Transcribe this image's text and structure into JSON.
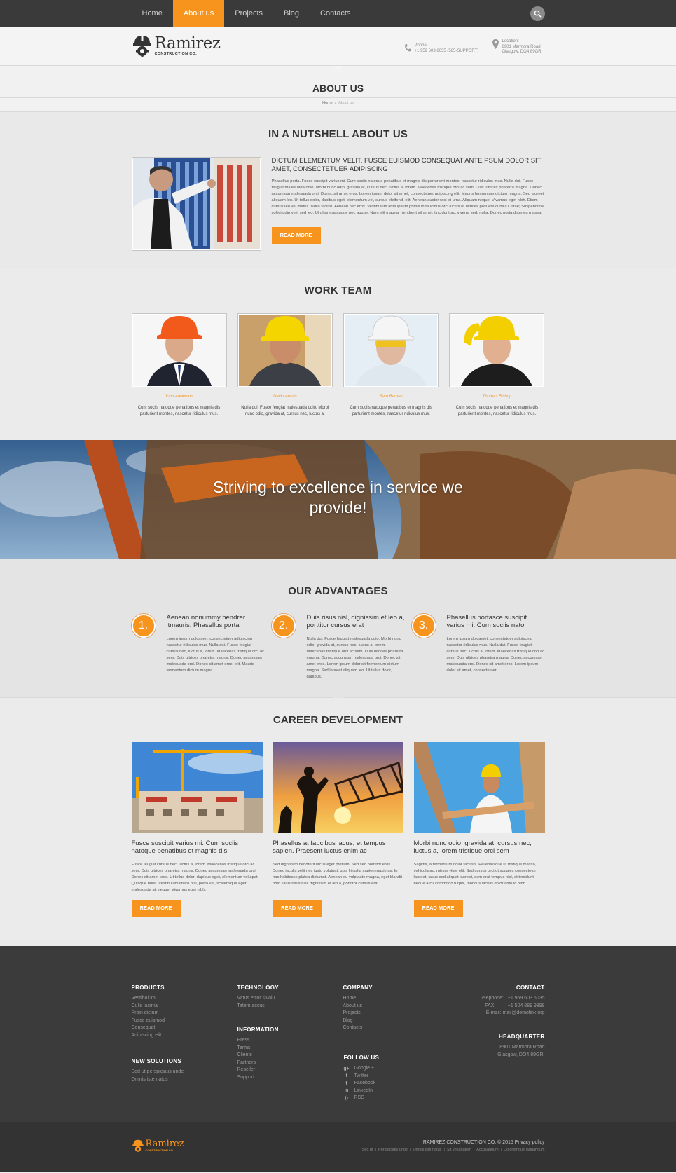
{
  "nav": {
    "items": [
      "Home",
      "About us",
      "Projects",
      "Blog",
      "Contacts"
    ],
    "active_index": 1
  },
  "header": {
    "logo_name": "Ramirez",
    "logo_sub": "CONSTRUCTION CO.",
    "phone_label": "Phone:",
    "phone_value": "+1 959 603 6035 (585-SUPPORT)",
    "location_label": "Location:",
    "location_line1": "8901 Marmora Road",
    "location_line2": "Glasgow, DO4 89GR."
  },
  "page_title": {
    "title": "ABOUT US",
    "breadcrumb_home": "Home",
    "breadcrumb_sep": "/",
    "breadcrumb_current": "About us"
  },
  "nutshell": {
    "heading": "IN A NUTSHELL ABOUT US",
    "subheading": "DICTUM ELEMENTUM VELIT. FUSCE EUISMOD CONSEQUAT ANTE PSUM DOLOR SIT AMET, CONSECTETUER ADIPISCING",
    "body": "Phasellus porta. Fusce suscipit varius mi. Cum sociis natoque penatibus et magnis dis parturient montes, nascetur ridiculus mus. Nulla dui. Fusce feugiat malesuada odio. Morbi nunc odio, gravida at, cursus nec, luctus a, lorem. Maecenas tristique orci ac sem. Duis ultrices pharetra magna. Donec accumsan malesuada orci. Donec sit amet eros. Lorem ipsum dolor sit amet, consectetuer adipiscing elit. Mauris fermentum dictum magna. Sed laoreet aliquam leo. Ut tellus dolor, dapibus eget, elementum vel, cursus eleifend, elit. Aenean auctor wisi et urna. Aliquam neque. Vivamus eget nibh. Etiam cursus leo vel metus. Nulla facilisi. Aenean nec eros. Vestibulum ante ipsum primis in faucibus orci luctus et ultrices posuere cubilia Curae; Suspendisse sollicitudin velit sed leo. Ut pharetra augue nec augue. Nam elit magna, hendrerit sit amet, tincidunt ac, viverra sed, nulla. Donec porta diam eu massa.",
    "button": "READ MORE"
  },
  "team": {
    "heading": "WORK TEAM",
    "members": [
      {
        "name": "John Anderson",
        "desc": "Cum sociis natoque penatibus et magnis dis parturient montes, nascetur ridiculus mus."
      },
      {
        "name": "David Austin",
        "desc": "Nulla dui. Fusce feugiat malesuada odio. Morbi nunc odio, gravida at, cursus nec, luctus a."
      },
      {
        "name": "Sam Barnes",
        "desc": "Cum sociis natoque penatibus et magnis dis parturient montes, nascetur ridiculus mus."
      },
      {
        "name": "Thomas Bishop",
        "desc": "Cum sociis natoque penatibus et magnis dis parturient montes, nascetur ridiculus mus."
      }
    ]
  },
  "banner": {
    "line1": "Striving to excellence in service we",
    "line2": "provide!"
  },
  "advantages": {
    "heading": "OUR ADVANTAGES",
    "items": [
      {
        "num": "1.",
        "head": "Aenean nonummy hendrer itmauris. Phasellus porta",
        "body": "Lorem ipsum dolcamet, consectetuer adipiscing nascetur ridiculus mus. Nulla dui. Fusce feugiat cursus nec, luctus a, lorem. Maecenas tristique orci ac sem. Duis ultrices pharetra magna. Donec accumsan malesuada orci. Donec sit amet eros. elit. Mauris fermentum dictum magna."
      },
      {
        "num": "2.",
        "head": "Duis risus nisl, dignissim et leo a, porttitor cursus erat",
        "body": "Nulla dui. Fusce feugiat malesuada odio. Morbi nunc odio, gravida at, cursus nec, luctus a, lorem. Maecenas tristique orci ac sem. Duis ultrices pharetra magna. Donec accumsan malesuada orci. Donec sit amet eros. Lorem ipsum dolor sit fermentum dictum magna. Sed laoreet aliquam leo. Ut tellus dolor, dapibus."
      },
      {
        "num": "3.",
        "head": "Phasellus portasce suscipit varius mi. Cum sociis nato",
        "body": "Lorem ipsum dolcamet, consectetuer adipiscing nascetur ridiculus mus. Nulla dui. Fusce feugiat cursus nec, luctus a, lorem. Maecenas tristique orci ac sem. Duis ultrices pharetra magna. Donec accumsan malesuada orci. Donec sit amet eros. Lorem ipsum dolor sit amet, consectetuer."
      }
    ]
  },
  "career": {
    "heading": "CAREER DEVELOPMENT",
    "items": [
      {
        "head": "Fusce suscipit varius mi. Cum sociis natoque penatibus et magnis dis",
        "body": "Fusce feugiat cursus nec, luctus a, lorem. Maecenas tristique orci ac sem. Duis ultrices pharetra magna. Donec accumsan malesuada orci. Donec sit amet eros. Ut tellus dolor, dapibus eget, elementum volutpat. Quisque nulla. Vestibulum libero nisl, porta vel, scelerisque eget, malesuada at, neque. Vivamus eget nibh.",
        "button": "READ MORE"
      },
      {
        "head": "Phasellus at faucibus lacus, et tempus sapien. Praesent luctus enim ac",
        "body": "Sed dignissim hendrerit lacus eget pretium. Sed sed porttitor eros. Donec iaculis velit nec justo volutpat, quis fringilla sapien maximus. In hac habitasse platea dictumst. Aenean eu vulputate magna, eget blandit odio. Duis risus nisl, dignissim et leo a, porttitor cursus erat.",
        "button": "READ MORE"
      },
      {
        "head": "Morbi nunc odio, gravida at, cursus nec, luctus a, lorem tristique orci sem",
        "body": "Sagittis, a fermentum dolor facilisis. Pellentesque ut tristique massa, vehicula ac, rutrum vitae elit. Sed cursus orci ut sodales consectetur laoreet, lacus sed aliquet laoreet, sem erat tempus nisl, et tincidunt neque arcu commodo turpis, rhoncus iaculis dolor ante id nibh.",
        "button": "READ MORE"
      }
    ]
  },
  "footer": {
    "products": {
      "title": "PRODUCTS",
      "items": [
        "Vestibulum",
        "Culis lacinia",
        "Proin dictum",
        "Fusce euismod",
        "Consequat",
        "Adipiscing elit"
      ]
    },
    "new_solutions": {
      "title": "NEW SOLUTIONS",
      "items": [
        "Sed ut perspiciatis unde",
        "Omnis iste natus"
      ]
    },
    "technology": {
      "title": "TECHNOLOGY",
      "items": [
        "Vatus error sivolu",
        "Tatem accus"
      ]
    },
    "information": {
      "title": "INFORMATION",
      "items": [
        "Press",
        "Terms",
        "Clients",
        "Partners",
        "Reseller",
        "Support"
      ]
    },
    "company": {
      "title": "COMPANY",
      "items": [
        "Home",
        "About us",
        "Projects",
        "Blog",
        "Contacts"
      ]
    },
    "follow": {
      "title": "FOLLOW US",
      "items": [
        {
          "icon": "google-plus-icon",
          "glyph": "g+",
          "label": "Google +"
        },
        {
          "icon": "twitter-icon",
          "glyph": "t",
          "label": "Twitter"
        },
        {
          "icon": "facebook-icon",
          "glyph": "f",
          "label": "Facebook"
        },
        {
          "icon": "linkedin-icon",
          "glyph": "in",
          "label": "LinkedIn"
        },
        {
          "icon": "rss-icon",
          "glyph": "))",
          "label": "RSS"
        }
      ]
    },
    "contact": {
      "title": "CONTACT",
      "lines": [
        "Telephone:   +1 959 603 6035",
        "FAX:         +1 504 889 9898",
        "E-mail: mail@demolink.org"
      ]
    },
    "headquarter": {
      "title": "HEADQUARTER",
      "lines": [
        "8901 Marmora Road",
        "Glasgow, DO4 89GR."
      ]
    }
  },
  "bottom": {
    "logo_name": "Ramirez",
    "logo_sub": "CONSTRUCTION CO.",
    "copyright": "RAMIREZ CONSTRUCTION CO. © 2015 Privacy policy",
    "links": "Sed ut  |  Perspiciatis unde  |  Omnis iste natus  |  Sit voluptatem  |  Accusantium  |  Doloremque laudantium"
  },
  "colors": {
    "accent": "#f7941d",
    "dark": "#3a3a3a"
  }
}
